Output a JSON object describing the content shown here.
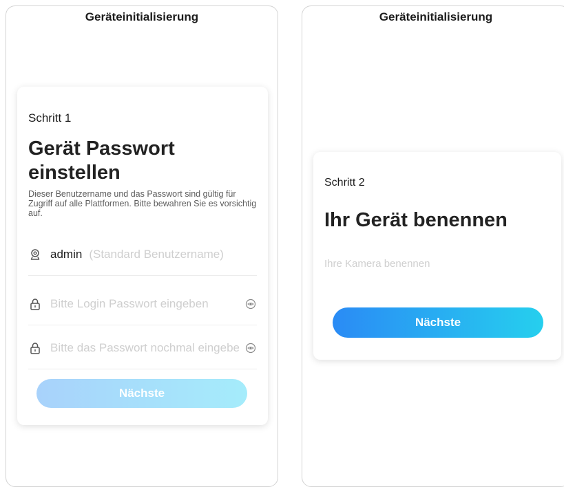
{
  "screens": [
    {
      "header_title": "Geräteinitialisierung",
      "step_label": "Schritt 1",
      "step_title": "Gerät Passwort einstellen",
      "description": "Dieser Benutzername und das Passwort sind gültig für Zugriff auf alle Plattformen. Bitte bewahren Sie es vorsichtig auf.",
      "username": {
        "icon": "user-icon",
        "value": "admin",
        "hint": "(Standard Benutzername)"
      },
      "password": {
        "icon": "lock-icon",
        "placeholder": "Bitte Login Passwort eingeben"
      },
      "confirm_password": {
        "icon": "lock-icon",
        "placeholder": "Bitte das Passwort nochmal eingeben"
      },
      "next_label": "Nächste",
      "next_enabled": false
    },
    {
      "header_title": "Geräteinitialisierung",
      "step_label": "Schritt 2",
      "step_title": "Ihr Gerät benennen",
      "name_input": {
        "placeholder": "Ihre Kamera benennen"
      },
      "next_label": "Nächste",
      "next_enabled": true
    }
  ],
  "colors": {
    "button_disabled_start": "#a8d2fb",
    "button_disabled_end": "#a5ecfb",
    "button_enabled_start": "#2a8bf5",
    "button_enabled_end": "#26cfee",
    "placeholder": "#cfcfcf",
    "icon": "#555555"
  }
}
